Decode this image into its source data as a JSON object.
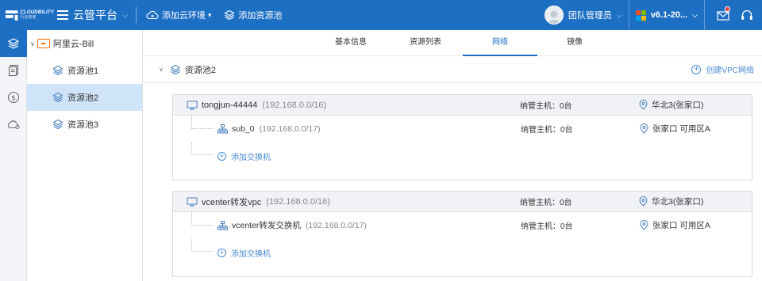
{
  "brand": {
    "name_line1": "CLOUDBILITY",
    "name_line2": "行云管家"
  },
  "header": {
    "app_title": "云管平台",
    "actions": [
      {
        "label": "添加云环境",
        "icon": "cloud-add-icon"
      },
      {
        "label": "添加资源池",
        "icon": "layers-icon"
      }
    ],
    "user_name": "团队管理员",
    "version": "v6.1-20...",
    "accent": "#1d6fc4"
  },
  "rail": {
    "items": [
      "layers-icon",
      "document-icon",
      "dollar-icon",
      "cloud-gear-icon"
    ]
  },
  "tree": {
    "root": "阿里云-Bill",
    "pools": [
      "资源池1",
      "资源池2",
      "资源池3"
    ],
    "selected_index": 1
  },
  "tabs": [
    "基本信息",
    "资源列表",
    "网络",
    "镜像"
  ],
  "active_tab": 2,
  "pool": {
    "name": "资源池2",
    "create_vpc": "创建VPC网络"
  },
  "vpcs": [
    {
      "name": "tongjun-44444",
      "cidr": "(192.168.0.0/16)",
      "hosts": "纳管主机：0台",
      "region": "华北3(张家口)",
      "subnets": [
        {
          "name": "sub_0",
          "cidr": "(192.168.0.0/17)",
          "hosts": "纳管主机：0台",
          "zone": "张家口 可用区A"
        }
      ],
      "add_switch": "添加交换机"
    },
    {
      "name": "vcenter转发vpc",
      "cidr": "(192.168.0.0/16)",
      "hosts": "纳管主机：0台",
      "region": "华北3(张家口)",
      "subnets": [
        {
          "name": "vcenter转发交换机",
          "cidr": "(192.168.0.0/17)",
          "hosts": "纳管主机：0台",
          "zone": "张家口 可用区A"
        }
      ],
      "add_switch": "添加交换机"
    }
  ],
  "colors": {
    "primary": "#1d6fc4",
    "link": "#4a8ad6",
    "selected_bg": "#cfe4f8",
    "aliyun_orange": "#ff6a00"
  }
}
